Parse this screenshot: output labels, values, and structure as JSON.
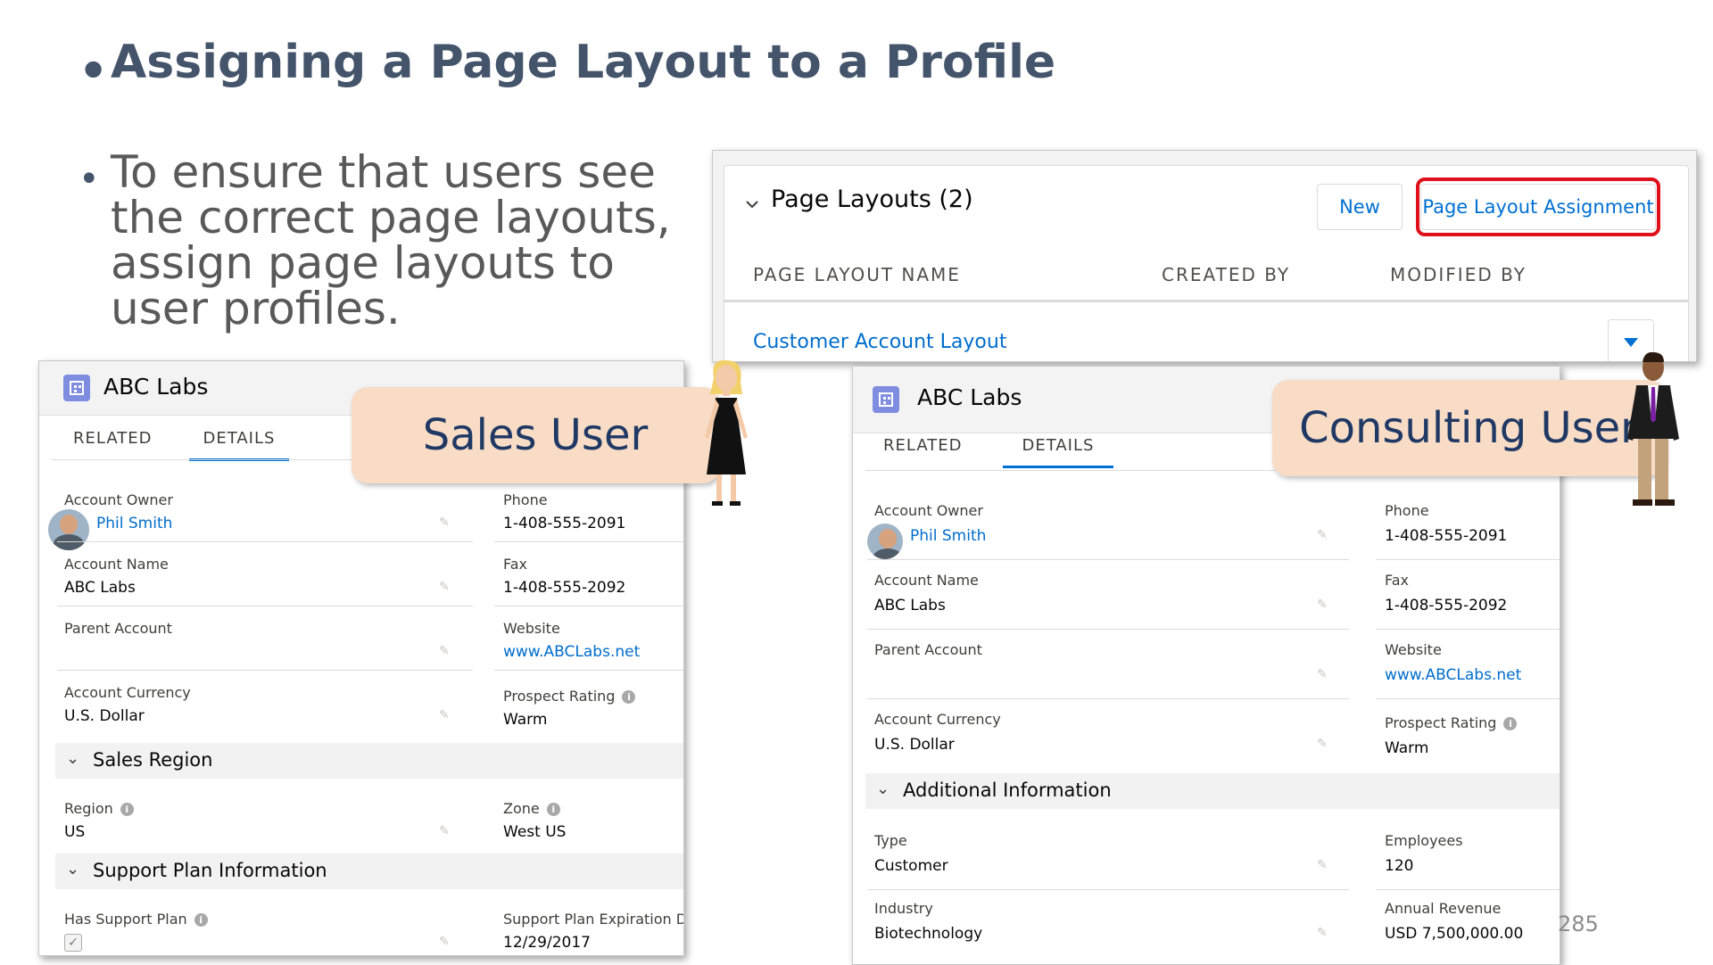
{
  "slide": {
    "title": "Assigning a Page Layout to a Profile",
    "subtitle": "To ensure that users see the correct page layouts, assign page layouts to user profiles.",
    "bullet": "•",
    "slide_number": "285"
  },
  "page_layouts": {
    "title": "Page Layouts (2)",
    "new_button": "New",
    "assignment_button": "Page Layout Assignment",
    "columns": [
      "PAGE LAYOUT NAME",
      "CREATED BY",
      "MODIFIED BY"
    ],
    "first_row": "Customer Account Layout",
    "highlight_color": "#e0101b"
  },
  "callouts": {
    "sales": "Sales User",
    "consulting": "Consulting User"
  },
  "left_card": {
    "title": "ABC Labs",
    "tabs": [
      "RELATED",
      "DETAILS"
    ],
    "active_tab": "DETAILS",
    "fields": {
      "account_owner_label": "Account Owner",
      "account_owner": "Phil Smith",
      "phone_label": "Phone",
      "phone": "1-408-555-2091",
      "account_name_label": "Account Name",
      "account_name": "ABC Labs",
      "fax_label": "Fax",
      "fax": "1-408-555-2092",
      "parent_account_label": "Parent Account",
      "website_label": "Website",
      "website": "www.ABCLabs.net",
      "currency_label": "Account Currency",
      "currency": "U.S. Dollar",
      "rating_label": "Prospect Rating",
      "rating": "Warm"
    },
    "section1": "Sales Region",
    "region_label": "Region",
    "region": "US",
    "zone_label": "Zone",
    "zone": "West US",
    "section2": "Support Plan Information",
    "support_label": "Has Support Plan",
    "support_checked": true,
    "expiration_label": "Support Plan Expiration Date",
    "expiration": "12/29/2017"
  },
  "right_card": {
    "title": "ABC Labs",
    "tabs": [
      "RELATED",
      "DETAILS"
    ],
    "active_tab": "DETAILS",
    "fields": {
      "account_owner_label": "Account Owner",
      "account_owner": "Phil Smith",
      "phone_label": "Phone",
      "phone": "1-408-555-2091",
      "account_name_label": "Account Name",
      "account_name": "ABC Labs",
      "fax_label": "Fax",
      "fax": "1-408-555-2092",
      "parent_account_label": "Parent Account",
      "website_label": "Website",
      "website": "www.ABCLabs.net",
      "currency_label": "Account Currency",
      "currency": "U.S. Dollar",
      "rating_label": "Prospect Rating",
      "rating": "Warm"
    },
    "section1": "Additional Information",
    "type_label": "Type",
    "type": "Customer",
    "employees_label": "Employees",
    "employees": "120",
    "industry_label": "Industry",
    "industry": "Biotechnology",
    "revenue_label": "Annual Revenue",
    "revenue": "USD 7,500,000.00"
  },
  "icons": [
    "chevron-down-icon",
    "account-icon",
    "pencil-icon",
    "info-icon",
    "caret-down-icon",
    "checkbox-icon"
  ]
}
